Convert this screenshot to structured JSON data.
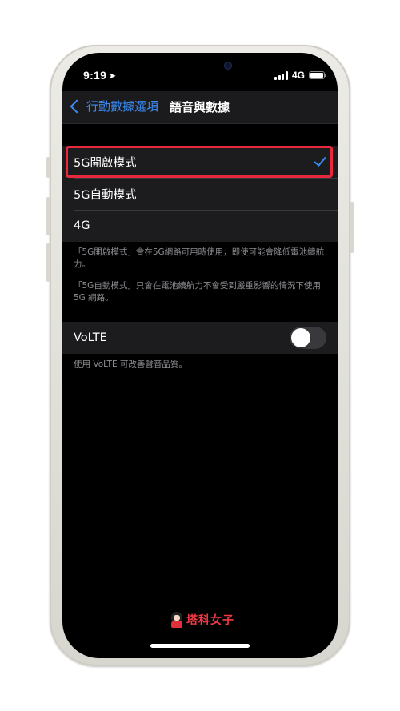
{
  "status_bar": {
    "time": "9:19",
    "network": "4G"
  },
  "nav": {
    "back_label": "行動數據選項",
    "title": "語音與數據"
  },
  "mode_options": [
    {
      "label": "5G開啟模式",
      "selected": true
    },
    {
      "label": "5G自動模式",
      "selected": false
    },
    {
      "label": "4G",
      "selected": false
    }
  ],
  "mode_footnote_1": "「5G開啟模式」會在5G網路可用時使用，即使可能會降低電池續航力。",
  "mode_footnote_2": "「5G自動模式」只會在電池續航力不會受到嚴重影響的情況下使用 5G 網路。",
  "volte": {
    "label": "VoLTE",
    "enabled": false,
    "footnote": "使用 VoLTE 可改善聲音品質。"
  },
  "watermark": {
    "text": "塔科女子"
  },
  "colors": {
    "accent": "#3b8df5",
    "highlight": "#e8283c",
    "background": "#000000",
    "cell": "#1c1c1e",
    "footnote": "#8e8e93"
  }
}
